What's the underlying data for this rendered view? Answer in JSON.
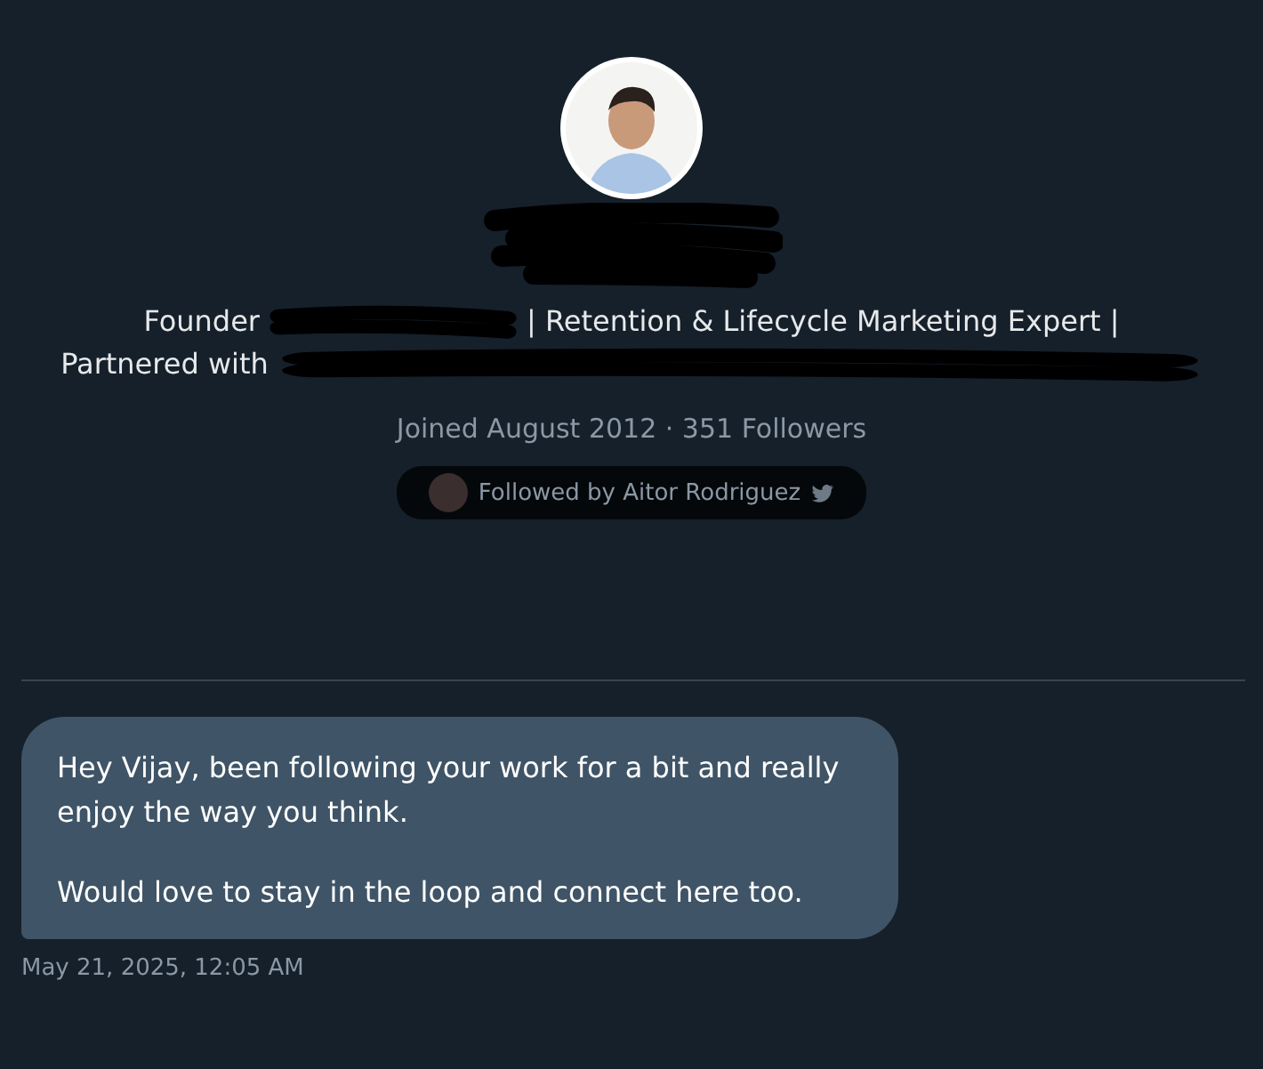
{
  "profile": {
    "bio_lines": [
      [
        {
          "kind": "text",
          "text": "Founder"
        },
        {
          "kind": "mask"
        },
        {
          "kind": "text",
          "text": "| Retention & Lifecycle Marketing Expert |"
        }
      ],
      [
        {
          "kind": "text",
          "text": "Partnered with"
        },
        {
          "kind": "longmask"
        }
      ]
    ],
    "joined": "Joined August 2012 · 351 Followers",
    "followed_by": "Followed by Aitor Rodriguez"
  },
  "messages": [
    {
      "paragraphs": [
        "Hey Vijay, been following your work for a bit and really enjoy the way you think.",
        "Would love to stay in the loop and connect here too."
      ],
      "time": "May 21, 2025, 12:05 AM"
    }
  ]
}
